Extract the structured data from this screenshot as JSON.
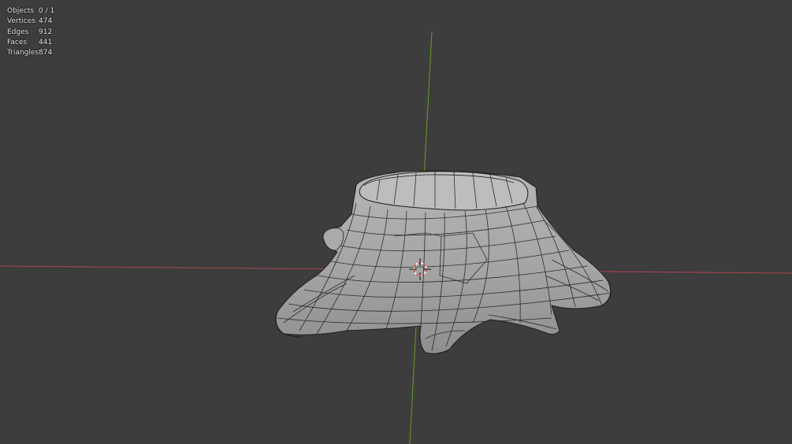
{
  "stats": [
    {
      "label": "Objects",
      "value": "0 / 1"
    },
    {
      "label": "Vertices",
      "value": "474"
    },
    {
      "label": "Edges",
      "value": "912"
    },
    {
      "label": "Faces",
      "value": "441"
    },
    {
      "label": "Triangles",
      "value": "874"
    }
  ],
  "colors": {
    "background": "#3d3d3d",
    "axis_x": "#b04450",
    "axis_y": "#6a9a2a",
    "mesh_fill": "#a9a9a9",
    "wire": "#1e1e1e",
    "cursor": "#d0504a"
  },
  "icons": [
    "3d-cursor-icon"
  ]
}
